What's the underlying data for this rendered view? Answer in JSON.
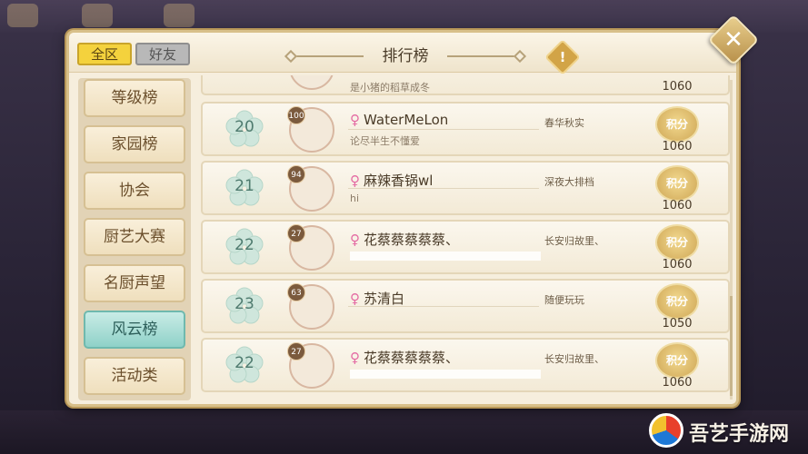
{
  "header": {
    "tabs": [
      {
        "label": "全区",
        "active": true
      },
      {
        "label": "好友",
        "active": false
      }
    ],
    "title": "排行榜",
    "info_icon": "exclamation-icon",
    "close_icon": "close-icon"
  },
  "sidebar": {
    "items": [
      {
        "label": "等级榜",
        "active": false
      },
      {
        "label": "家园榜",
        "active": false
      },
      {
        "label": "协会",
        "active": false
      },
      {
        "label": "厨艺大赛",
        "active": false
      },
      {
        "label": "名厨声望",
        "active": false
      },
      {
        "label": "风云榜",
        "active": true
      },
      {
        "label": "活动类",
        "active": false
      }
    ]
  },
  "list": {
    "partial_top": {
      "signature": "是小猪的稻草成冬",
      "score": "1060"
    },
    "rows": [
      {
        "rank": "20",
        "level": "100",
        "gender": "♀",
        "name": "WaterMeLon",
        "signature": "论尽半生不懂爱",
        "guild": "春华秋实",
        "badge": "积分",
        "score": "1060"
      },
      {
        "rank": "21",
        "level": "94",
        "gender": "♀",
        "name": "麻辣香锅wl",
        "signature": "hi",
        "guild": "深夜大排档",
        "badge": "积分",
        "score": "1060"
      },
      {
        "rank": "22",
        "level": "27",
        "gender": "♀",
        "name": "花蔡蔡蔡蔡蔡、",
        "signature": "",
        "guild": "长安归故里、",
        "badge": "积分",
        "score": "1060"
      },
      {
        "rank": "23",
        "level": "63",
        "gender": "♀",
        "name": "苏清白",
        "signature": "",
        "guild": "随便玩玩",
        "badge": "积分",
        "score": "1050"
      },
      {
        "rank": "22",
        "level": "27",
        "gender": "♀",
        "name": "花蔡蔡蔡蔡蔡、",
        "signature": "",
        "guild": "长安归故里、",
        "badge": "积分",
        "score": "1060"
      }
    ]
  },
  "watermark": {
    "text": "吾艺手游网"
  },
  "colors": {
    "active_tab": "#f4d23d",
    "active_side": "#8fd1c8",
    "rank_text": "#4f7b6f",
    "gender": "#e46aa3"
  }
}
